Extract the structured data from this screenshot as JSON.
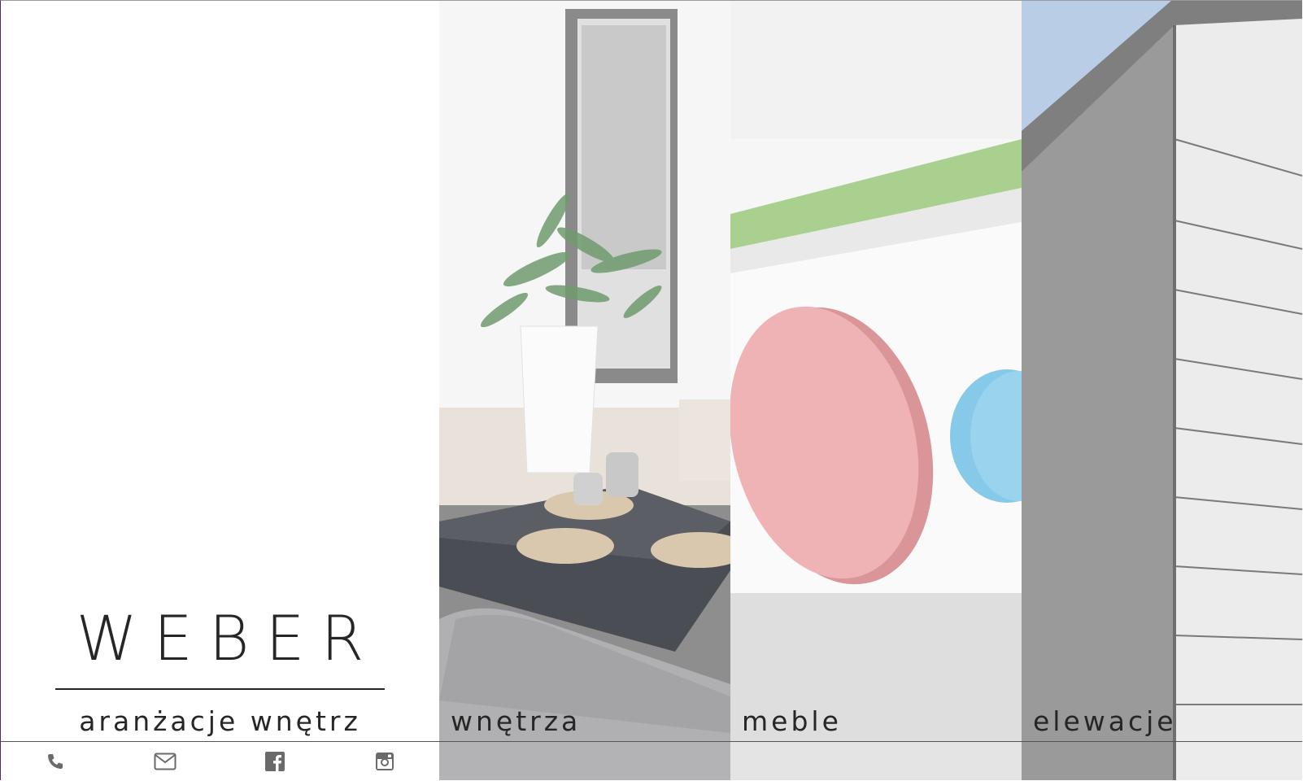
{
  "brand": {
    "logo": "WEBER",
    "tagline": "aranżacje wnętrz"
  },
  "social": {
    "icons": [
      "phone-icon",
      "mail-icon",
      "facebook-icon",
      "instagram-icon"
    ]
  },
  "categories": [
    {
      "label": "wnętrza"
    },
    {
      "label": "meble"
    },
    {
      "label": "elewacje"
    }
  ],
  "colors": {
    "text": "#262626",
    "icon": "#6a6a6a",
    "accent_green": "#a9d08e",
    "accent_red": "#efb3b5",
    "accent_blue": "#87c9e8"
  }
}
